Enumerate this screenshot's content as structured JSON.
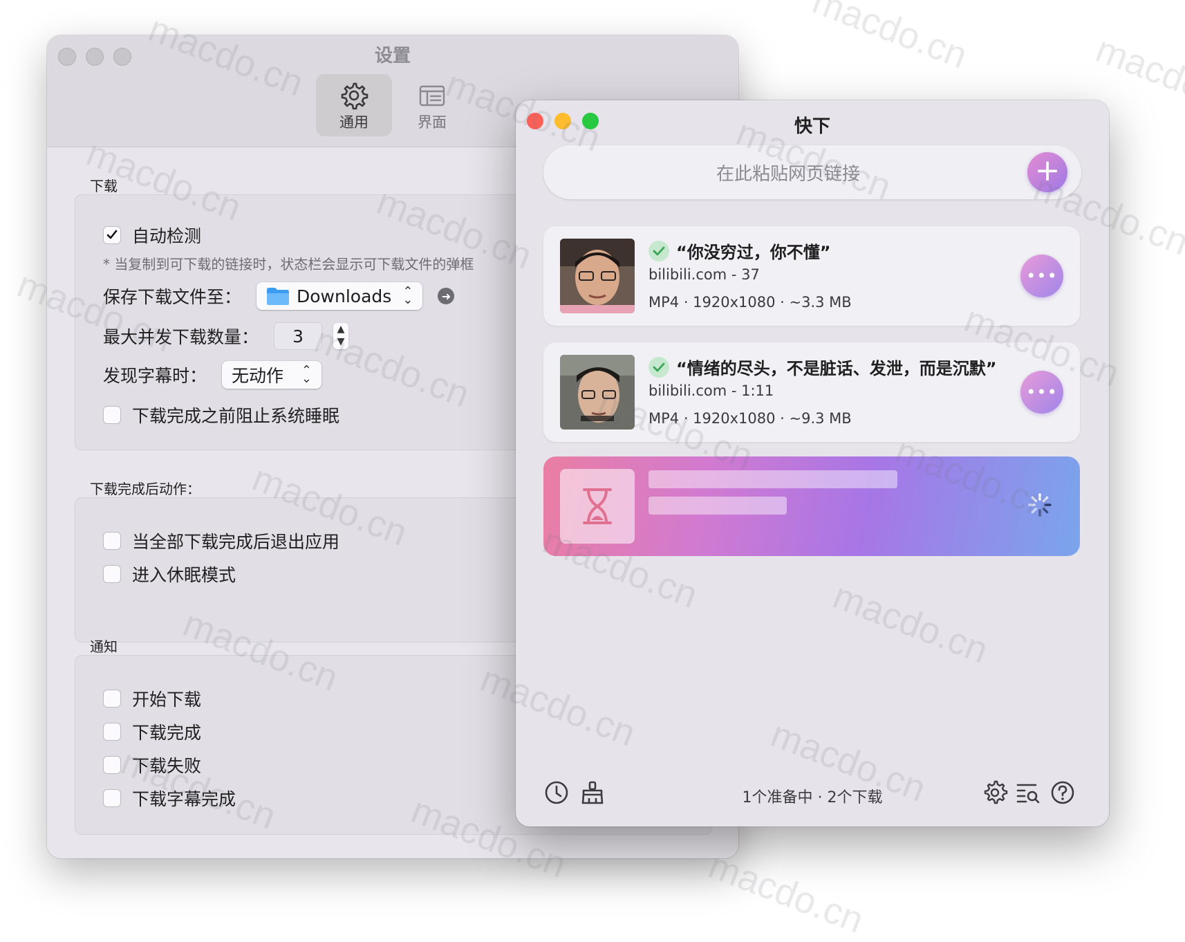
{
  "settings": {
    "title": "设置",
    "tabs": [
      {
        "label": "通用"
      },
      {
        "label": "界面"
      }
    ],
    "download_section": {
      "label": "下载",
      "auto_detect": {
        "label": "自动检测",
        "checked": true
      },
      "hint": "* 当复制到可下载的链接时，状态栏会显示可下载文件的弹框",
      "save_to": {
        "label": "保存下载文件至：",
        "value": "Downloads"
      },
      "max_concurrent": {
        "label": "最大并发下载数量：",
        "value": "3"
      },
      "subtitle": {
        "label": "发现字幕时：",
        "value": "无动作"
      },
      "prevent_sleep": {
        "label": "下载完成之前阻止系统睡眠",
        "checked": false
      }
    },
    "after_section": {
      "label": "下载完成后动作：",
      "quit_app": {
        "label": "当全部下载完成后退出应用",
        "checked": false
      },
      "sleep_mode": {
        "label": "进入休眠模式",
        "checked": false
      }
    },
    "notify_section": {
      "label": "通知",
      "items": [
        {
          "label": "开始下载",
          "checked": false
        },
        {
          "label": "下载完成",
          "checked": false
        },
        {
          "label": "下载失败",
          "checked": false
        },
        {
          "label": "下载字幕完成",
          "checked": false
        }
      ]
    }
  },
  "main": {
    "title": "快下",
    "url_placeholder": "在此粘贴网页链接",
    "add_button": "+",
    "items": [
      {
        "title": "“你没穷过，你不懂”",
        "source": "bilibili.com - 37",
        "meta": "MP4 · 1920x1080 · ~3.3 MB",
        "status": "done"
      },
      {
        "title": "“情绪的尽头，不是脏话、发泄，而是沉默”",
        "source": "bilibili.com - 1:11",
        "meta": "MP4 · 1920x1080 · ~9.3 MB",
        "status": "done"
      }
    ],
    "more_button": "•••",
    "footer_status": "1个准备中 · 2个下载"
  },
  "watermark": "macdo.cn",
  "colors": {
    "close": "#fe5f57",
    "minimize": "#febc2e",
    "zoom": "#28c840",
    "accent": "#a77ae6"
  }
}
